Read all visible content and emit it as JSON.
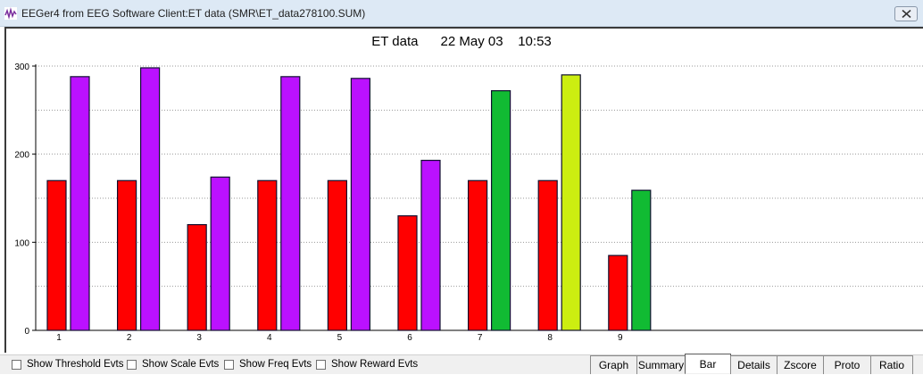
{
  "window": {
    "title": "EEGer4 from EEG Software  Client:ET data  (SMR\\ET_data278100.SUM)"
  },
  "header": {
    "client": "ET data",
    "date": "22 May 03",
    "time": "10:53"
  },
  "chart_data": {
    "type": "bar",
    "categories": [
      "1",
      "2",
      "3",
      "4",
      "5",
      "6",
      "7",
      "8",
      "9"
    ],
    "series": [
      {
        "values": [
          170,
          170,
          120,
          170,
          170,
          130,
          170,
          170,
          85
        ],
        "colors": [
          "#ff0000",
          "#ff0000",
          "#ff0000",
          "#ff0000",
          "#ff0000",
          "#ff0000",
          "#ff0000",
          "#ff0000",
          "#ff0000"
        ]
      },
      {
        "values": [
          288,
          298,
          174,
          288,
          286,
          193,
          272,
          290,
          159
        ],
        "colors": [
          "#bb11ff",
          "#bb11ff",
          "#bb11ff",
          "#bb11ff",
          "#bb11ff",
          "#bb11ff",
          "#11bb33",
          "#ccee11",
          "#11bb33"
        ]
      }
    ],
    "yticks": [
      "0",
      "100",
      "200",
      "300"
    ],
    "ylim": [
      0,
      300
    ],
    "grid": true,
    "legend": "none"
  },
  "options": {
    "show_threshold": "Show Threshold Evts",
    "show_scale": "Show Scale Evts",
    "show_freq": "Show Freq Evts",
    "show_reward": "Show Reward Evts"
  },
  "tabs": [
    {
      "label": "Graph",
      "active": false
    },
    {
      "label": "Summary",
      "active": false
    },
    {
      "label": "Bar",
      "active": true
    },
    {
      "label": "Details",
      "active": false
    },
    {
      "label": "Zscore",
      "active": false
    },
    {
      "label": "Proto",
      "active": false
    },
    {
      "label": "Ratio",
      "active": false
    }
  ],
  "icons": {
    "app": "brainwave-icon",
    "close": "close-icon"
  }
}
